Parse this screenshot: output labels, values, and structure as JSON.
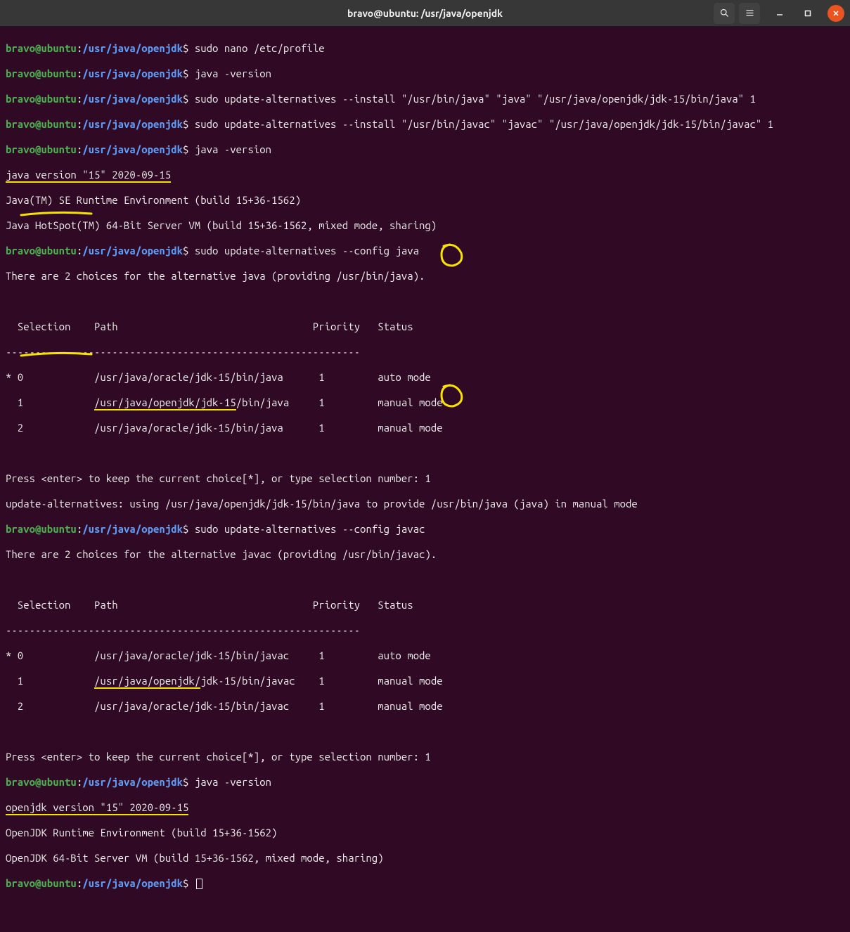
{
  "window": {
    "title": "bravo@ubuntu: /usr/java/openjdk"
  },
  "prompt": {
    "user_host": "bravo@ubuntu",
    "colon": ":",
    "path": "/usr/java/openjdk",
    "dollar": "$"
  },
  "cmds": {
    "c1": "sudo nano /etc/profile",
    "c2": "java -version",
    "c3": "sudo update-alternatives --install \"/usr/bin/java\" \"java\" \"/usr/java/openjdk/jdk-15/bin/java\" 1",
    "c4": "sudo update-alternatives --install \"/usr/bin/javac\" \"javac\" \"/usr/java/openjdk/jdk-15/bin/javac\" 1",
    "c5": "java -version",
    "c6": "sudo update-alternatives --config java",
    "c7": "sudo update-alternatives --config javac",
    "c8": "java -version"
  },
  "out": {
    "java_version_a": "java version \"15\" 2020-09-15",
    "jre_a": "Java(TM) SE Runtime Environment (build 15+36-1562)",
    "jvm_a": "Java HotSpot(TM) 64-Bit Server VM (build 15+36-1562, mixed mode, sharing)",
    "alt_java_msg": "There are 2 choices for the alternative java (providing /usr/bin/java).",
    "alt_javac_msg": "There are 2 choices for the alternative javac (providing /usr/bin/javac).",
    "table_header": "  Selection    Path                                 Priority   Status",
    "table_rule": "------------------------------------------------------------",
    "java_row0": "* 0            /usr/java/oracle/jdk-15/bin/java      1         auto mode",
    "java_row1_a": "  1",
    "java_row1_b": "/usr/java/openjdk/jdk-15",
    "java_row1_c": "/bin/java     1         manual mode",
    "java_row2": "  2            /usr/java/oracle/jdk-15/bin/java      1         manual mode",
    "javac_row0": "* 0            /usr/java/oracle/jdk-15/bin/javac     1         auto mode",
    "javac_row1_a": "  1",
    "javac_row1_b": "/usr/java/openjdk/",
    "javac_row1_c": "jdk-15/bin/javac    1         manual mode",
    "javac_row2": "  2            /usr/java/oracle/jdk-15/bin/javac     1         manual mode",
    "press_prefix": "Press <enter> to keep the current choice[*], or type selection number:",
    "press_choice": " 1",
    "update_msg": "update-alternatives: using /usr/java/openjdk/jdk-15/bin/java to provide /usr/bin/java (java) in manual mode",
    "openjdk_version": "openjdk version \"15\" 2020-09-15",
    "openjdk_jre": "OpenJDK Runtime Environment (build 15+36-1562)",
    "openjdk_jvm": "OpenJDK 64-Bit Server VM (build 15+36-1562, mixed mode, sharing)"
  },
  "spacing": {
    "gap12": "            "
  }
}
